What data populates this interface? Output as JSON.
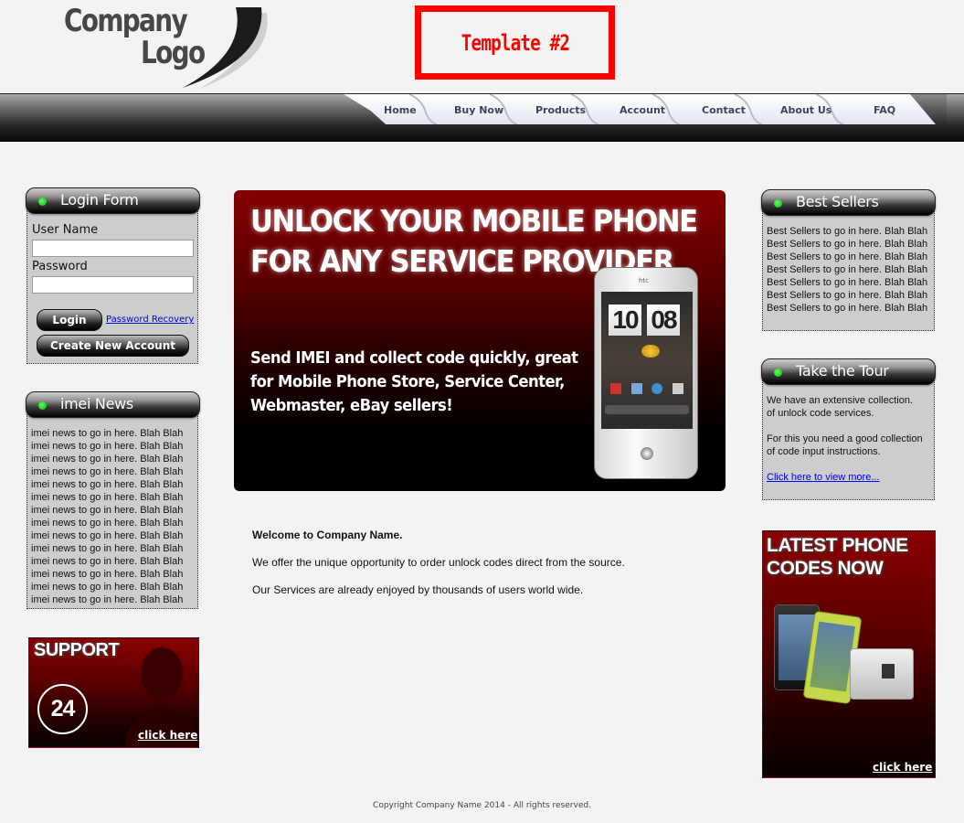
{
  "header": {
    "logo": {
      "line1": "Company",
      "line2": "Logo"
    },
    "template_label": "Template #2"
  },
  "nav": {
    "items": [
      {
        "label": "Home"
      },
      {
        "label": "Buy Now"
      },
      {
        "label": "Products"
      },
      {
        "label": "Account"
      },
      {
        "label": "Contact"
      },
      {
        "label": "About Us"
      },
      {
        "label": "FAQ"
      }
    ]
  },
  "login": {
    "title": "Login Form",
    "username_label": "User Name",
    "username_value": "",
    "password_label": "Password",
    "password_value": "",
    "login_button": "Login",
    "recovery_link": "Password Recovery",
    "create_button": "Create New Account"
  },
  "news": {
    "title": "imei News",
    "items": [
      "imei news to go in here. Blah Blah",
      "imei news to go in here. Blah Blah",
      "imei news to go in here. Blah Blah",
      "imei news to go in here. Blah Blah",
      "imei news to go in here. Blah Blah",
      "imei news to go in here. Blah Blah",
      "imei news to go in here. Blah Blah",
      "imei news to go in here. Blah Blah",
      "imei news to go in here. Blah Blah",
      "imei news to go in here. Blah Blah",
      "imei news to go in here. Blah Blah",
      "imei news to go in here. Blah Blah",
      "imei news to go in here. Blah Blah",
      "imei news to go in here. Blah Blah"
    ]
  },
  "support_banner": {
    "title": "SUPPORT",
    "badge": "24",
    "link": "click here"
  },
  "hero": {
    "headline_1": "UNLOCK YOUR MOBILE PHONE",
    "headline_2": "FOR ANY SERVICE PROVIDER",
    "subtext": "Send IMEI and collect code quickly, great for Mobile Phone Store, Service Center, Webmaster, eBay sellers!",
    "phone_brand": "htc",
    "clock_hours": "10",
    "clock_minutes": "08"
  },
  "welcome": {
    "heading": "Welcome to Company Name.",
    "para1": "We offer the unique opportunity to order unlock codes direct from the source.",
    "para2": "Our Services are already enjoyed by thousands of users world wide."
  },
  "best_sellers": {
    "title": "Best Sellers",
    "items": [
      "Best Sellers to go in here. Blah Blah",
      "Best Sellers to go in here. Blah Blah",
      "Best Sellers to go in here. Blah Blah",
      "Best Sellers to go in here. Blah Blah",
      "Best Sellers to go in here. Blah Blah",
      "Best Sellers to go in here. Blah Blah",
      "Best Sellers to go in here. Blah Blah"
    ]
  },
  "tour": {
    "title": "Take the Tour",
    "line1": "We have an extensive collection.",
    "line2": "of unlock code services.",
    "line3": "For this you need a good collection",
    "line4": "of code input instructions.",
    "link": "Click here to view more..."
  },
  "latest_banner": {
    "title_1": "LATEST PHONE",
    "title_2": "CODES NOW",
    "link": "click here"
  },
  "footer": {
    "copyright": "Copyright Company Name 2014 - All rights reserved."
  },
  "colors": {
    "accent_red": "#ff0000",
    "banner_red": "#850000",
    "status_green": "#08b208",
    "link_blue": "#0000ee",
    "page_bg": "#f3f3f3"
  }
}
